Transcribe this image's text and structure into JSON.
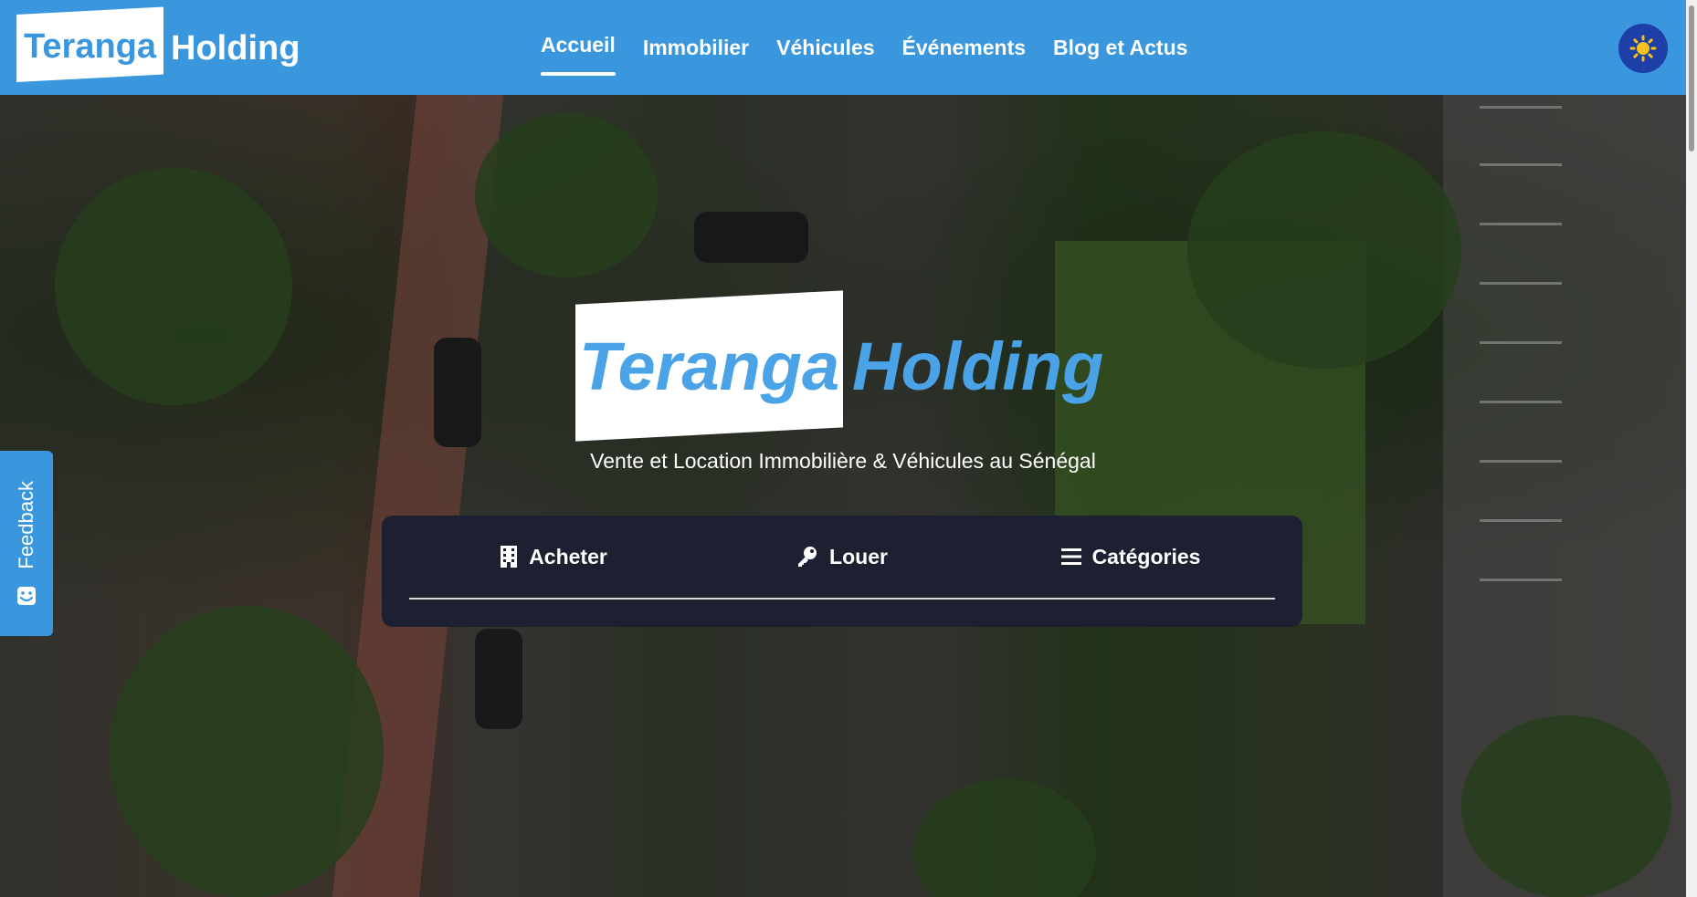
{
  "brand": {
    "logo_boxed": "Teranga",
    "logo_rest": "Holding",
    "color": "#3a97de"
  },
  "nav": {
    "items": [
      {
        "label": "Accueil",
        "active": true
      },
      {
        "label": "Immobilier",
        "active": false
      },
      {
        "label": "Véhicules",
        "active": false
      },
      {
        "label": "Événements",
        "active": false
      },
      {
        "label": "Blog et Actus",
        "active": false
      }
    ]
  },
  "theme_toggle": {
    "icon": "sun-icon"
  },
  "hero": {
    "logo_boxed": "Teranga",
    "logo_rest": "Holding",
    "tagline": "Vente et Location Immobilière & Véhicules au Sénégal"
  },
  "search": {
    "tabs": [
      {
        "label": "Acheter",
        "icon": "building-icon"
      },
      {
        "label": "Louer",
        "icon": "key-icon"
      },
      {
        "label": "Catégories",
        "icon": "list-icon"
      }
    ]
  },
  "feedback": {
    "label": "Feedback",
    "icon": "smile-icon"
  }
}
